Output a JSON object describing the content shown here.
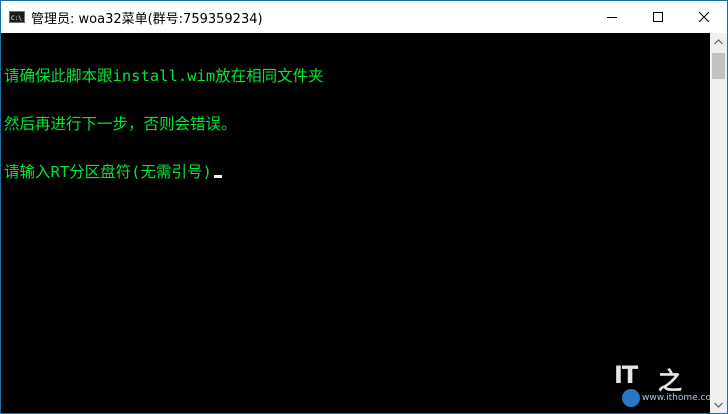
{
  "window": {
    "title": "管理员:  woa32菜单(群号:759359234)",
    "colors": {
      "console_background": "#000000",
      "console_text": "#00e632",
      "cursor": "#f0f0f0",
      "titlebar": "#ffffff",
      "border": "#1a6fa3"
    }
  },
  "icons": {
    "app": "command-prompt-icon",
    "minimize": "minimize-icon",
    "maximize": "maximize-icon",
    "close": "close-icon",
    "scroll_up": "chevron-up-icon",
    "scroll_down": "chevron-down-icon"
  },
  "console": {
    "lines": [
      "请确保此脚本跟install.wim放在相同文件夹",
      "然后再进行下一步，否则会错误。",
      "请输入RT分区盘符(无需引号)"
    ]
  },
  "watermark": {
    "logo_text": "IT",
    "logo_char": "之",
    "url": "www.ithome.com"
  }
}
